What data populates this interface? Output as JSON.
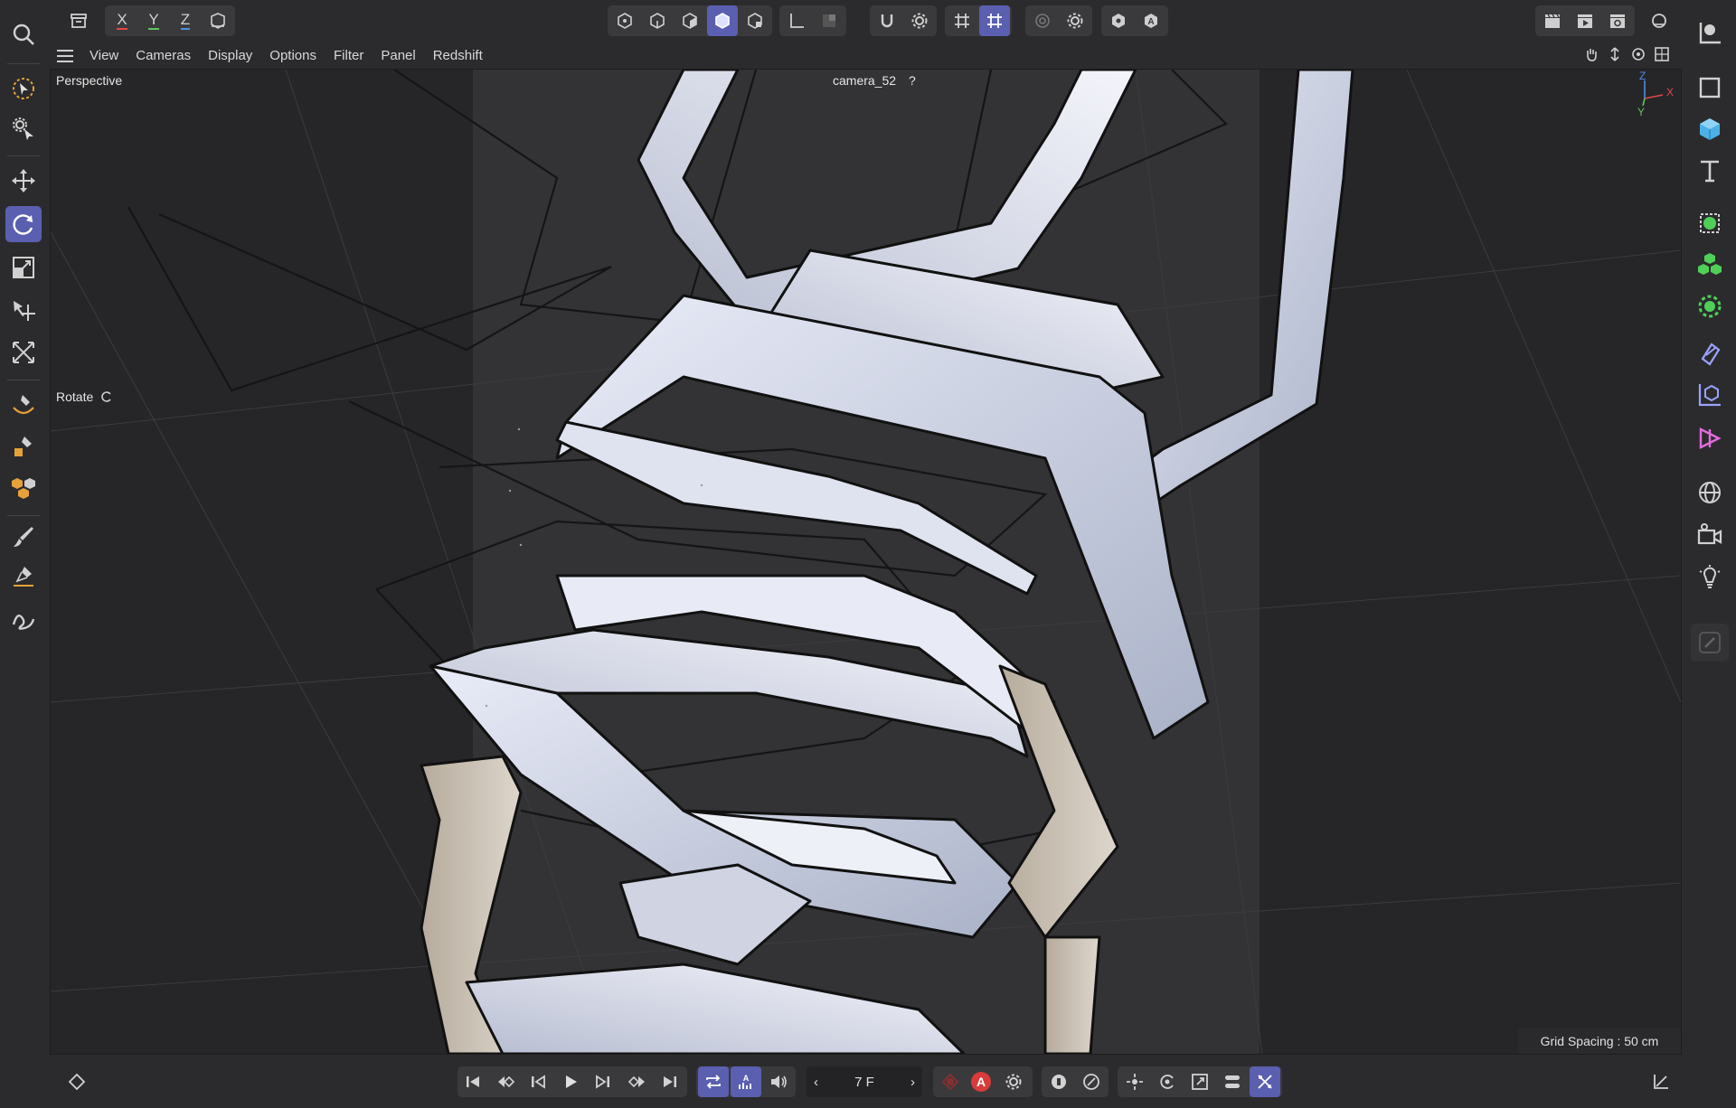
{
  "top_toolbar": {
    "axis_x": "X",
    "axis_y": "Y",
    "axis_z": "Z"
  },
  "viewport_menu": {
    "items": [
      "View",
      "Cameras",
      "Display",
      "Options",
      "Filter",
      "Panel",
      "Redshift"
    ]
  },
  "viewport": {
    "view_name": "Perspective",
    "camera_name": "camera_52",
    "camera_help": "?",
    "tool_label": "Rotate",
    "grid_spacing": "Grid Spacing : 50 cm",
    "gizmo_z": "Z",
    "gizmo_x": "X",
    "gizmo_y": "Y"
  },
  "timeline": {
    "current_frame": "7 F",
    "frame_prev": "‹",
    "frame_next": "›",
    "autokey_label": "A"
  },
  "colors": {
    "accent": "#5a5fb0",
    "axis_x": "#e04848",
    "axis_y": "#5fc45f",
    "axis_z": "#4f8ee8",
    "record": "#d93b3b"
  }
}
